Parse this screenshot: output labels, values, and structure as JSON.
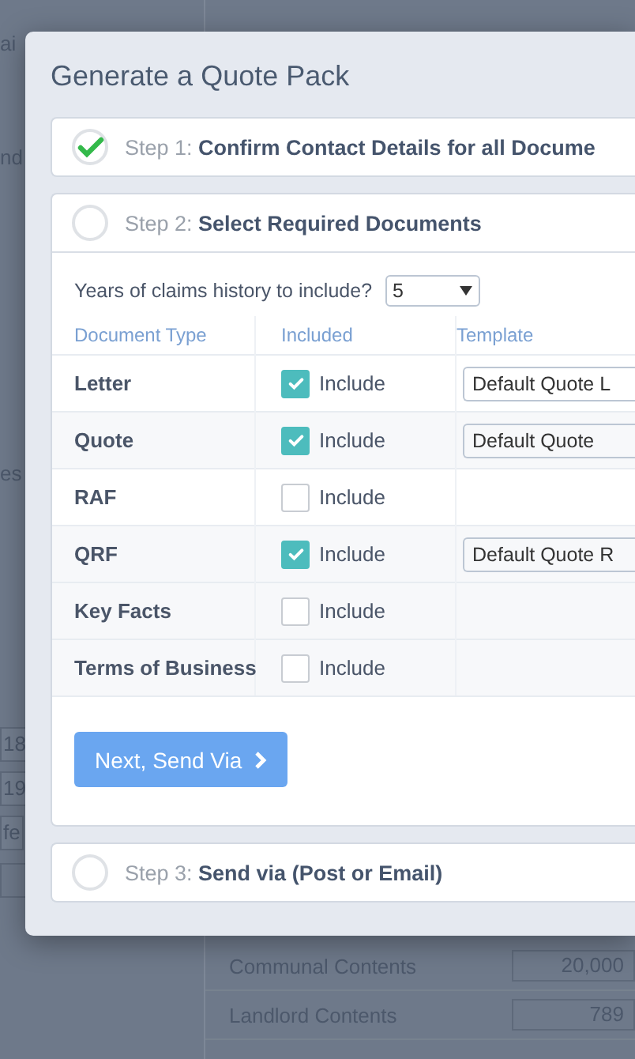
{
  "background_page": {
    "left_fragments": [
      "ai",
      "nd",
      "es",
      "18",
      "19",
      "fe"
    ],
    "rows": [
      {
        "label": "Communal Contents",
        "value": "20,000"
      },
      {
        "label": "Landlord Contents",
        "value": "789"
      }
    ]
  },
  "dialog": {
    "title": "Generate a Quote Pack",
    "steps": [
      {
        "label": "Step 1:",
        "title": "Confirm Contact Details for all Docume",
        "completed": true,
        "expanded": false
      },
      {
        "label": "Step 2:",
        "title": "Select Required Documents",
        "completed": false,
        "expanded": true
      },
      {
        "label": "Step 3:",
        "title": "Send via (Post or Email)",
        "completed": false,
        "expanded": false
      }
    ],
    "years_prompt": "Years of claims history to include?",
    "years_value": "5",
    "columns": [
      "Document Type",
      "Included",
      "Template"
    ],
    "documents": [
      {
        "type": "Letter",
        "checked": true,
        "include_label": "Include",
        "template": "Default Quote L"
      },
      {
        "type": "Quote",
        "checked": true,
        "include_label": "Include",
        "template": "Default Quote"
      },
      {
        "type": "RAF",
        "checked": false,
        "include_label": "Include"
      },
      {
        "type": "QRF",
        "checked": true,
        "include_label": "Include",
        "template": "Default Quote R"
      },
      {
        "type": "Key Facts",
        "checked": false,
        "include_label": "Include"
      },
      {
        "type": "Terms of Business",
        "checked": false,
        "include_label": "Include"
      }
    ],
    "next_button": "Next, Send Via"
  }
}
